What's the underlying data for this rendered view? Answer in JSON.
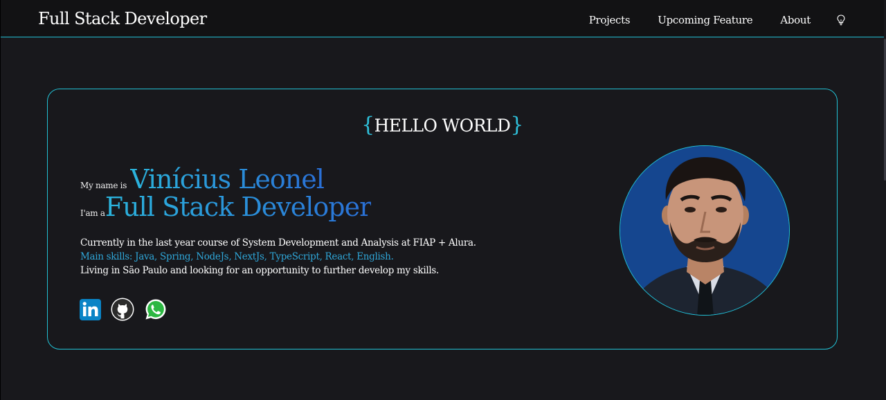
{
  "header": {
    "brand": "Full Stack Developer",
    "nav": [
      "Projects",
      "Upcoming Feature",
      "About"
    ],
    "theme_toggle_icon": "lightbulb-icon"
  },
  "hero": {
    "brace_open": "{",
    "hello": "HELLO WORLD",
    "brace_close": "}",
    "name_prefix": "My name is",
    "name": "Vinícius Leonel",
    "role_prefix": "I'am a",
    "role": "Full Stack Developer",
    "description": [
      "Currently in the last year course of System Development and Analysis at FIAP + Alura.",
      "Main skills: Java, Spring, NodeJs, NextJs, TypeScript, React, English.",
      "Living in São Paulo and looking for an opportunity to further develop my skills."
    ],
    "socials": [
      "linkedin-icon",
      "github-icon",
      "whatsapp-icon"
    ]
  },
  "colors": {
    "background": "#18181c",
    "navbar": "#121214",
    "accent": "#22c3d6",
    "gradient_start": "#2bb4dc",
    "gradient_end": "#2a6fd6",
    "skills_text": "#2fa7d9"
  }
}
